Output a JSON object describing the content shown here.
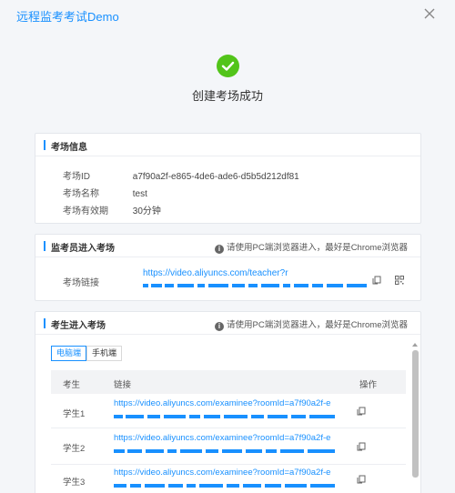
{
  "window": {
    "title": "远程监考考试Demo"
  },
  "success": {
    "message": "创建考场成功"
  },
  "room_info": {
    "heading": "考场信息",
    "fields": [
      {
        "label": "考场ID",
        "value": "a7f90a2f-e865-4de6-ade6-d5b5d212df81"
      },
      {
        "label": "考场名称",
        "value": "test"
      },
      {
        "label": "考场有效期",
        "value": "30分钟"
      }
    ]
  },
  "proctor": {
    "heading": "监考员进入考场",
    "tip": "请使用PC端浏览器进入，最好是Chrome浏览器",
    "link_label": "考场链接",
    "url": "https://video.aliyuncs.com/teacher?r"
  },
  "examinee": {
    "heading": "考生进入考场",
    "tip": "请使用PC端浏览器进入，最好是Chrome浏览器",
    "tabs": [
      {
        "label": "电脑端",
        "active": true
      },
      {
        "label": "手机端",
        "active": false
      }
    ],
    "columns": {
      "student": "考生",
      "link": "链接",
      "action": "操作"
    },
    "rows": [
      {
        "name": "学生1",
        "url": "https://video.aliyuncs.com/examinee?roomId=a7f90a2f-e"
      },
      {
        "name": "学生2",
        "url": "https://video.aliyuncs.com/examinee?roomId=a7f90a2f-e"
      },
      {
        "name": "学生3",
        "url": "https://video.aliyuncs.com/examinee?roomId=a7f90a2f-e"
      }
    ]
  },
  "colors": {
    "accent": "#1890ff",
    "success": "#52c41a"
  }
}
